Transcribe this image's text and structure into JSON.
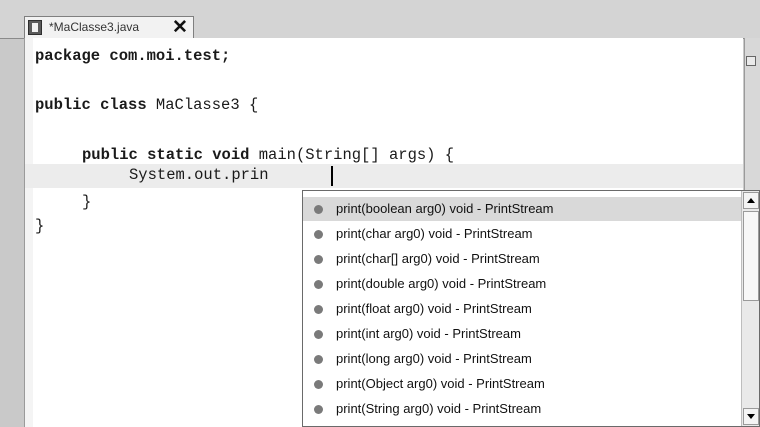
{
  "tab": {
    "title": "*MaClasse3.java",
    "close_label": "✕",
    "icon": "java-file-icon"
  },
  "code": {
    "line1": "package com.moi.test;",
    "line2_kw": "public class",
    "line2_rest": " MaClasse3 {",
    "line3_kw": "public static void",
    "line3_rest": " main(String[] args) {",
    "line4": "System.out.prin",
    "line5": "}",
    "line6": "}"
  },
  "completion": {
    "items": [
      {
        "label": "print(boolean arg0)  void - PrintStream"
      },
      {
        "label": "print(char arg0)  void - PrintStream"
      },
      {
        "label": "print(char[] arg0)  void - PrintStream"
      },
      {
        "label": "print(double arg0)  void - PrintStream"
      },
      {
        "label": "print(float arg0)  void - PrintStream"
      },
      {
        "label": "print(int arg0)  void - PrintStream"
      },
      {
        "label": "print(long arg0)  void - PrintStream"
      },
      {
        "label": "print(Object arg0)  void - PrintStream"
      },
      {
        "label": "print(String arg0)  void - PrintStream"
      }
    ],
    "selected_index": 0
  }
}
